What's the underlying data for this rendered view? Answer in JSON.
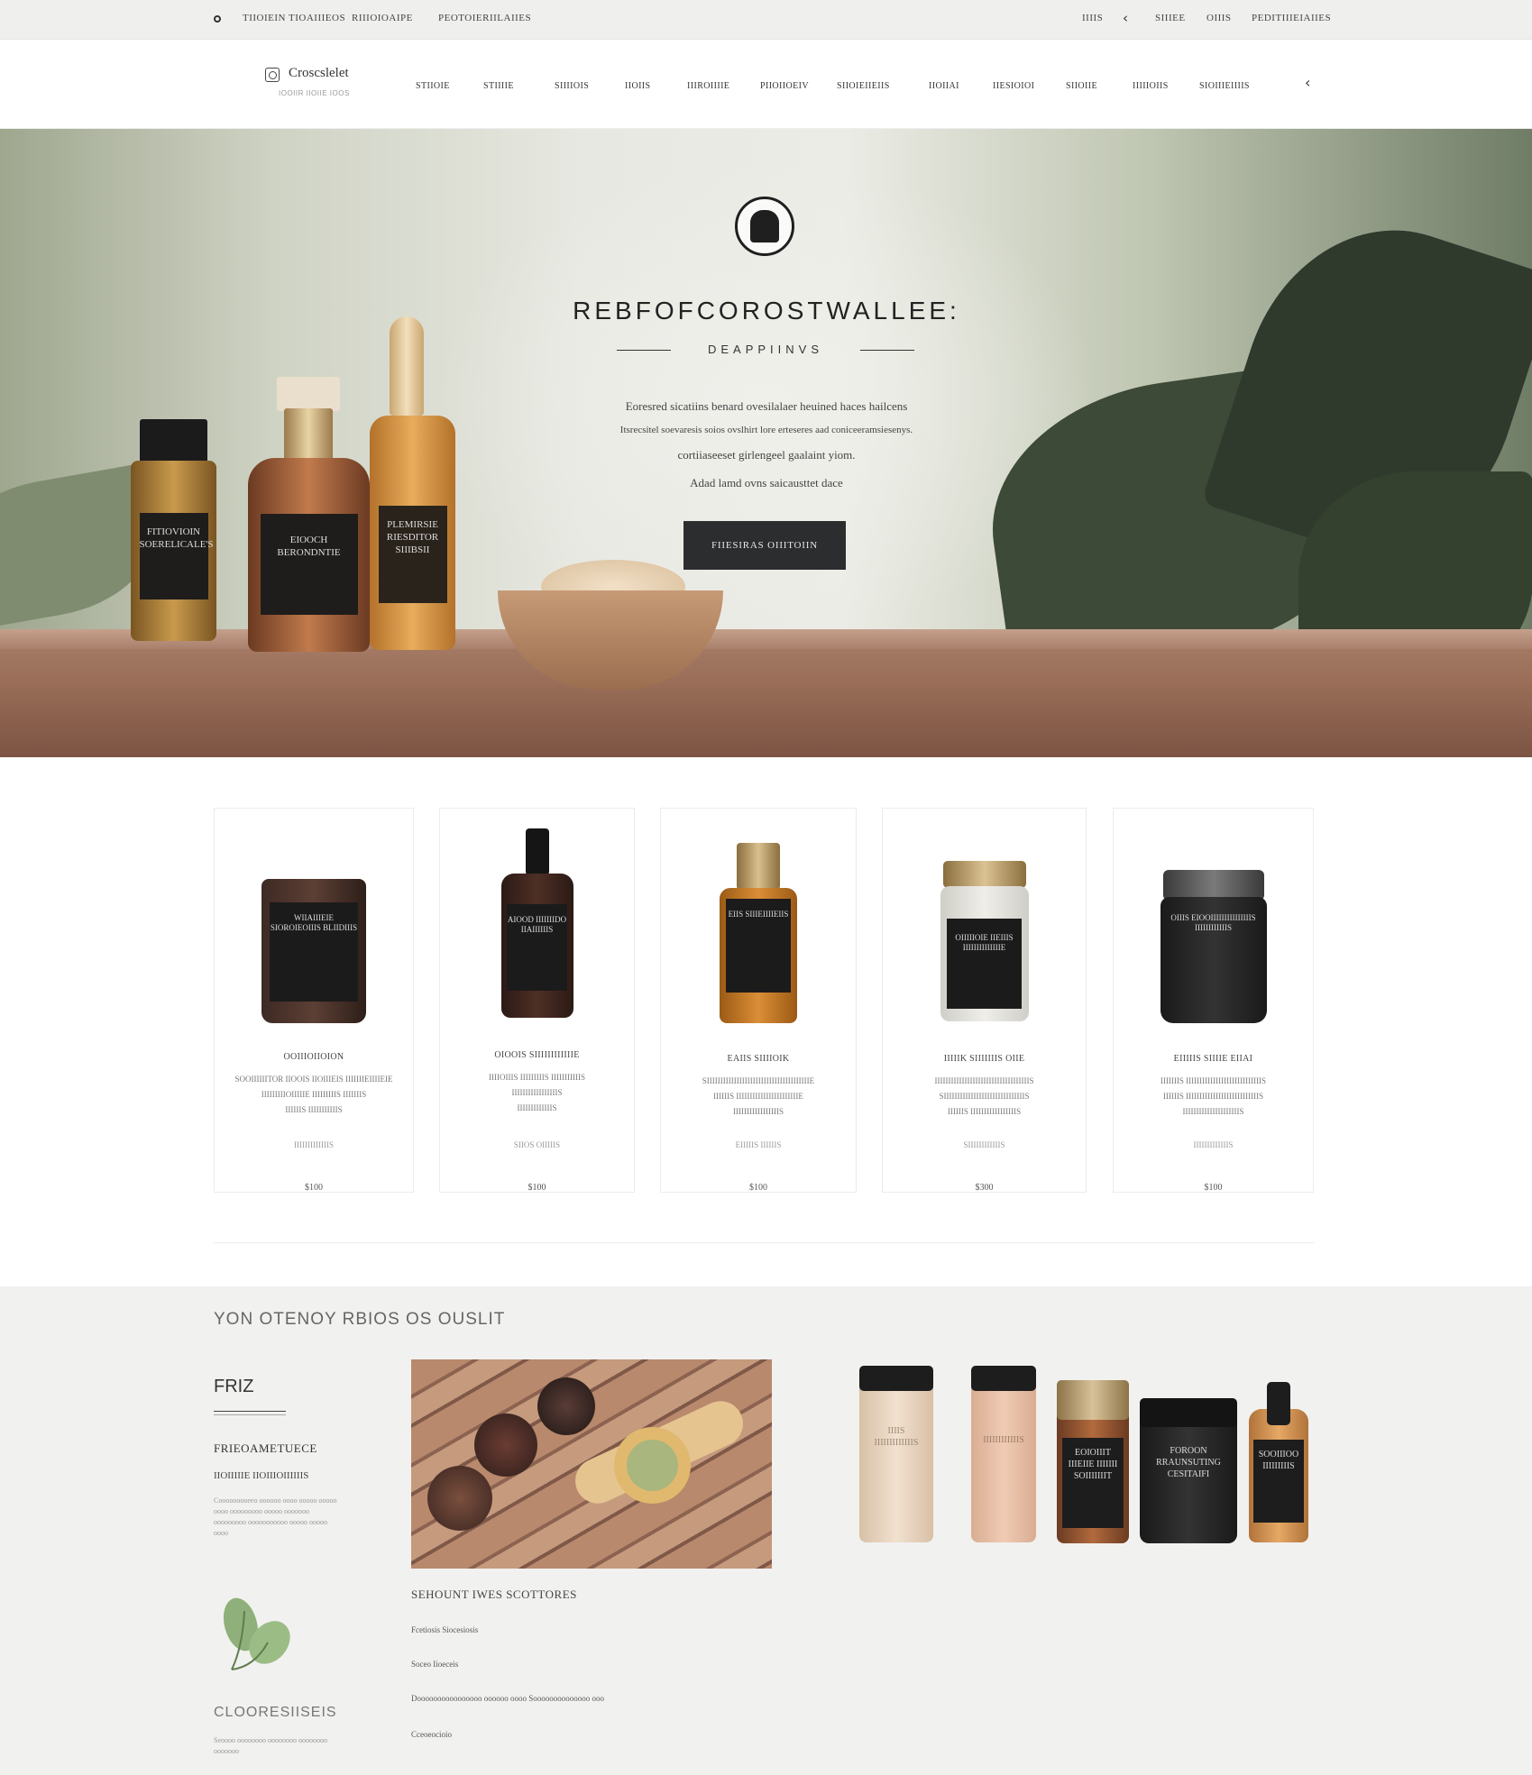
{
  "topbar": {
    "links_left": [
      "TIIOIEIN TIOAIIIEOS",
      "RIIIOIOAIPE",
      "PEOTOIERIILAIIES"
    ],
    "links_right": [
      "IIIIS",
      "SIIIEE",
      "OIIIS",
      "PEDITIIIEIAIIES"
    ]
  },
  "nav": {
    "logo_text": "Croscslelet",
    "logo_tagline": "IOOIIR IIOIIE IOOS",
    "items": [
      "STIIOIE",
      "STIIIIE",
      "SIIIIOIS",
      "IIOIIS",
      "IIIROIIIIE",
      "PIIOIIOEIV",
      "SIIOIEIIEIIS",
      "IIOIIAI",
      "IIESIOIOI",
      "SIIOIIE",
      "IIIIIOIIS",
      "SIOIIIEIIIIS"
    ]
  },
  "hero": {
    "title": "REBFOFCOROSTWALLEE:",
    "subtitle": "DEAPPIINVS",
    "lines": [
      "Eoresred sicatiins benard ovesilalaer heuined haces hailcens",
      "Itsrecsitel soevaresis soios ovslhirt lore erteseres aad coniceeramsiesenys.",
      "cortiiaseeset girlengeel gaalaint yiom.",
      "Adad lamd ovns saicausttet dace"
    ],
    "button_label": "FIIESIRAS OIIITOIIN",
    "bottle_labels": [
      "FITIOVIOIN SOERELICALE'S",
      "EIOOCH BERONDNTIE",
      "PLEMIRSIE RIESDITOR SIIIBSII"
    ]
  },
  "products": [
    {
      "label": "WIIAIIIEIE SIOROIEOIIIS BLIIDIIIS",
      "title": "OOIIIOIIOION",
      "desc": [
        "SOOIIIIIITOR IIOOIS IIOIIIEIS IIIIIIIEIIIIEIE",
        "IIIIIIIIIOIIIIIE IIIIIIIIIS IIIIIIIS",
        "IIIIIIS IIIIIIIIIIIS"
      ],
      "meta": "IIIIIIIIIIIIIS",
      "price": "$100"
    },
    {
      "label": "AIOOD IIIIIIIDO IIAIIIIIIS",
      "title": "OIOOIS SIIIIIIIIIIIIE",
      "desc": [
        "IIIIOIIIS IIIIIIIIIS IIIIIIIIIIIS",
        "IIIIIIIIIIIIIIIIIS",
        "IIIIIIIIIIIIIS"
      ],
      "meta": "SIIOS OIIIIIS",
      "price": "$100"
    },
    {
      "label": "EIIS SIIIEIIIIEIIS",
      "title": "EAIIS SIIIIOIK",
      "desc": [
        "SIIIIIIIIIIIIIIIIIIIIIIIIIIIIIIIIIIIIIIE",
        "IIIIIIS IIIIIIIIIIIIIIIIIIIIIIIE",
        "IIIIIIIIIIIIIIIIIS"
      ],
      "meta": "EIIIIIS IIIIIIS",
      "price": "$100"
    },
    {
      "label": "OIIIIIOIE IIEIIIS IIIIIIIIIIIIIIE",
      "title": "IIIIIK SIIIIIIIS OIIE",
      "desc": [
        "IIIIIIIIIIIIIIIIIIIIIIIIIIIIIIIIIIIS",
        "SIIIIIIIIIIIIIIIIIIIIIIIIIIIIIIS",
        "IIIIIIS IIIIIIIIIIIIIIIIIS"
      ],
      "meta": "SIIIIIIIIIIIIS",
      "price": "$300"
    },
    {
      "label": "OIIIS EIOOIIIIIIIIIIIIIIIS IIIIIIIIIIIIS",
      "title": "EIIIIIS SIIIIE EIIAI",
      "desc": [
        "IIIIIIIS IIIIIIIIIIIIIIIIIIIIIIIIIIIIS",
        "IIIIIIS IIIIIIIIIIIIIIIIIIIIIIIIIIIS",
        "IIIIIIIIIIIIIIIIIIIIIS"
      ],
      "meta": "IIIIIIIIIIIIIS",
      "price": "$100"
    }
  ],
  "lower": {
    "heading": "YON OTENOY RBIOS OS OUSLIT",
    "section_title": "FRIZ",
    "feature_title": "FRIEOAMETUECE",
    "feature_sub": "IIOIIIIIE IIOIIIOIIIIIIS",
    "feature_text": "Cooooooooeeo oooooo oooo ooooo ooooo oooo ooooooooo ooooo ooooooo ooooooooo ooooooooooo ooooo ooooo oooo",
    "footer_title": "CLOORESIISEIS",
    "footer_text": "Seoooo oooooooo oooooooo oooooooo ooooooo",
    "mid_title": "SEHOUNT IWES SCOTTORES",
    "mid_links": [
      "Fcetiosis Siocesiosis",
      "Soceo Iioeceis",
      "Doooooooooooooooo oooooo oooo Soooooooooooooo ooo",
      "Cceoeocioio"
    ],
    "group_labels": [
      "IIIIS IIIIIIIIIIIIIS",
      "IIIIIIIIIIIIS",
      "EOIOIIIT IIIEIIE IIIIIII SOIIIIIIIT",
      "FOROON RRAUNSUTING CESITAIFI",
      "SOOIIIOO IIIIIIIIIS"
    ]
  }
}
